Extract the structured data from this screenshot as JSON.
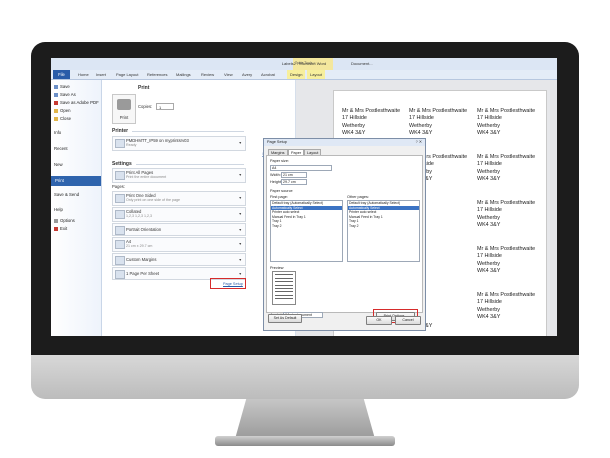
{
  "window": {
    "title": "Labels2 - Microsoft Word",
    "context_group": "Table Tools",
    "context_caption": "Document..."
  },
  "ribbon_tabs": [
    "Home",
    "Insert",
    "Page Layout",
    "References",
    "Mailings",
    "Review",
    "View",
    "Avery",
    "Acrobat"
  ],
  "context_tabs": [
    "Design",
    "Layout"
  ],
  "file_tab": "File",
  "backstage": {
    "top_items": [
      "Save",
      "Save As",
      "Save as Adobe PDF",
      "Open",
      "Close"
    ],
    "sections": [
      "Info",
      "Recent",
      "New"
    ],
    "active": "Print",
    "after": [
      "Save & Send",
      "Help"
    ],
    "bottom_items": [
      "Options",
      "Exit"
    ]
  },
  "print_panel": {
    "print_heading": "Print",
    "copies_label": "Copies:",
    "copies_value": "1",
    "print_button": "Print",
    "printer_heading": "Printer",
    "printer_name": "PMDHMTT_IP59 on myprintsrv03",
    "printer_status": "Ready",
    "printer_properties": "Printer Properties",
    "settings_heading": "Settings",
    "settings": [
      {
        "title": "Print All Pages",
        "sub": "Print the entire document"
      },
      {
        "title": "Print One Sided",
        "sub": "Only print on one side of the page"
      },
      {
        "title": "Collated",
        "sub": "1,2,3   1,2,3   1,2,3"
      },
      {
        "title": "Portrait Orientation",
        "sub": ""
      },
      {
        "title": "A4",
        "sub": "21 cm x 29.7 cm"
      },
      {
        "title": "Custom Margins",
        "sub": ""
      },
      {
        "title": "1 Page Per Sheet",
        "sub": ""
      }
    ],
    "pages_label": "Pages:",
    "page_setup": "Page Setup"
  },
  "label_text": [
    "Mr & Mrs Postlesthwaite",
    "17 Hillside",
    "Wetherby",
    "WK4 3&Y"
  ],
  "dialog": {
    "title": "Page Setup",
    "tabs": [
      "Margins",
      "Paper",
      "Layout"
    ],
    "active_tab": "Paper",
    "paper_size_label": "Paper size:",
    "paper_size": "A4",
    "width_label": "Width:",
    "width": "21 cm",
    "height_label": "Height:",
    "height": "29.7 cm",
    "paper_source_label": "Paper source",
    "first_page_label": "First page:",
    "other_pages_label": "Other pages:",
    "tray_options": [
      "Default tray (Automatically Select)",
      "Automatically Select",
      "Printer auto select",
      "Manual Feed in Tray 1",
      "Tray 1",
      "Tray 2"
    ],
    "preview_label": "Preview",
    "apply_to_label": "Apply to:",
    "apply_to_value": "Whole document",
    "print_options_button": "Print Options...",
    "set_default_button": "Set As Default",
    "ok_button": "OK",
    "cancel_button": "Cancel"
  }
}
